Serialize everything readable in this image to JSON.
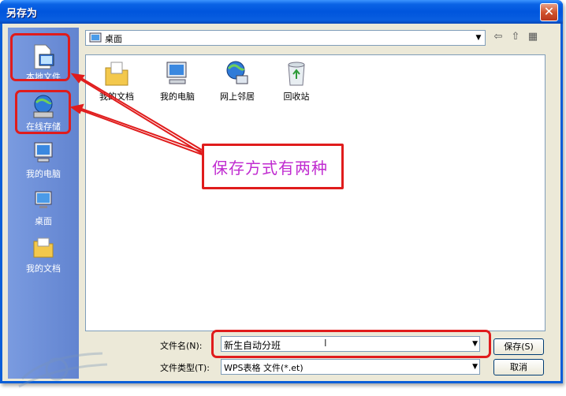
{
  "window": {
    "title": "另存为",
    "close_glyph": "✕"
  },
  "places": [
    {
      "name": "place-local-file",
      "label": "本地文件",
      "icon": "local-file-icon"
    },
    {
      "name": "place-online-storage",
      "label": "在线存储",
      "icon": "globe-drive-icon"
    },
    {
      "name": "place-my-computer",
      "label": "我的电脑",
      "icon": "computer-icon"
    },
    {
      "name": "place-desktop",
      "label": "桌面",
      "icon": "desktop-icon"
    },
    {
      "name": "place-my-documents",
      "label": "我的文档",
      "icon": "folder-icon"
    }
  ],
  "location": {
    "value": "桌面",
    "toolbar_icons": [
      "back-icon",
      "up-folder-icon",
      "new-folder-icon"
    ]
  },
  "files": [
    {
      "label": "我的文档",
      "icon": "documents-folder-icon"
    },
    {
      "label": "我的电脑",
      "icon": "computer-icon"
    },
    {
      "label": "网上邻居",
      "icon": "network-icon"
    },
    {
      "label": "回收站",
      "icon": "recycle-bin-icon"
    }
  ],
  "form": {
    "filename_label": "文件名(N):",
    "filename_value": "新生自动分班",
    "filetype_label": "文件类型(T):",
    "filetype_value": "WPS表格 文件(*.et)",
    "save_label": "保存(S)",
    "cancel_label": "取消"
  },
  "annotation": {
    "text": "保存方式有两种",
    "color": "#e01c1c",
    "text_color": "#c02bd0"
  }
}
